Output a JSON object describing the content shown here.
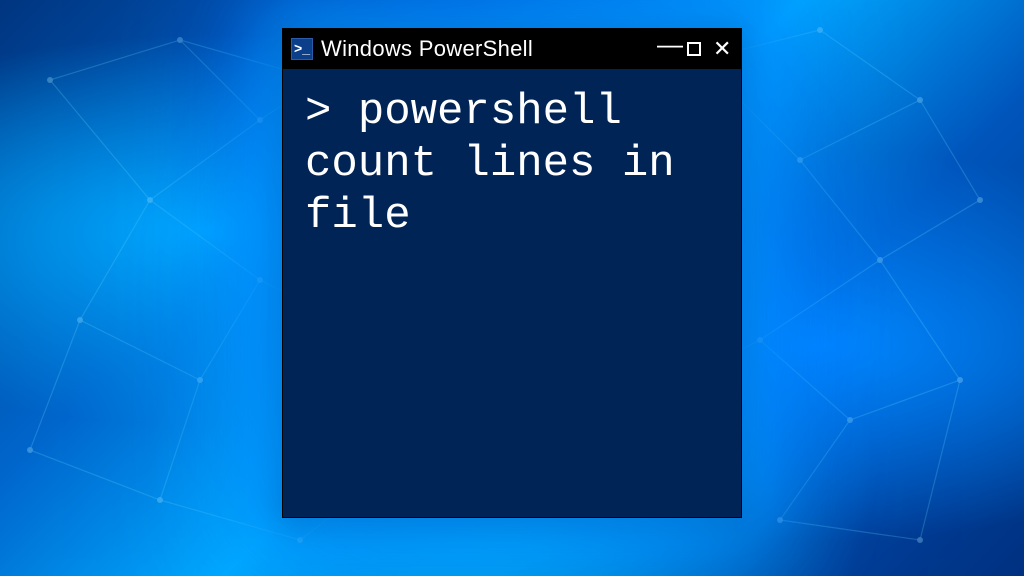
{
  "window": {
    "title": "Windows PowerShell",
    "icon_glyph": "≥_"
  },
  "terminal": {
    "prompt": ">",
    "command": "powershell count lines in file"
  },
  "colors": {
    "terminal_bg": "#012456",
    "titlebar_bg": "#000000",
    "text": "#ffffff"
  }
}
